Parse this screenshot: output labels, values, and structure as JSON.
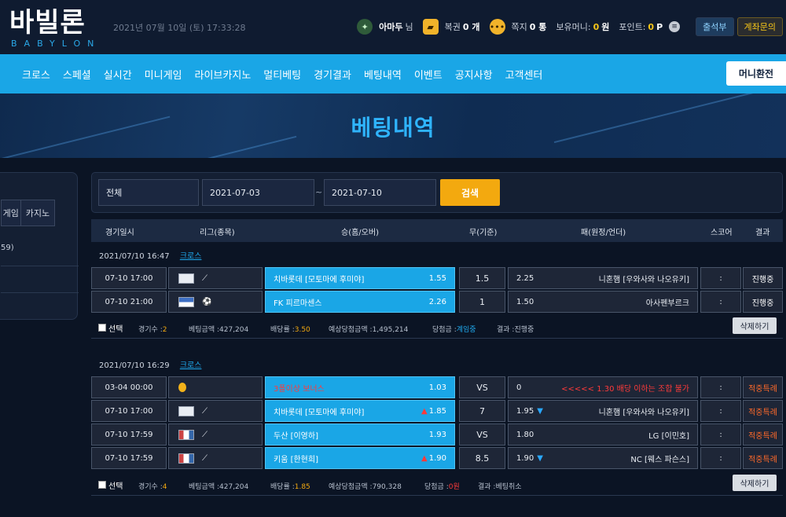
{
  "header": {
    "logo_kr": "바빌론",
    "logo_en": "BABYLON",
    "datetime": "2021년 07월 10일 (토) 17:33:28",
    "username": "아마두",
    "user_suffix": "님",
    "ticket_label": "복권",
    "ticket_value": "0 개",
    "msg_label": "쪽지",
    "msg_value": "0 통",
    "money_label": "보유머니:",
    "money_value": "0",
    "money_unit": "원",
    "point_label": "포인트:",
    "point_value": "0",
    "point_unit": "P",
    "attend_btn": "출석부",
    "account_btn": "계좌문의"
  },
  "nav": {
    "items": [
      "크로스",
      "스페셜",
      "실시간",
      "미니게임",
      "라이브카지노",
      "멀티베팅",
      "경기결과",
      "베팅내역",
      "이벤트",
      "공지사항",
      "고객센터"
    ],
    "money_btn": "머니환전"
  },
  "banner": {
    "title": "베팅내역"
  },
  "leftpanel": {
    "tab1": "게임",
    "tab2": "카지노",
    "text": "59)"
  },
  "search": {
    "type": "전체",
    "date_from": "2021-07-03",
    "tilde": "~",
    "date_to": "2021-07-10",
    "button": "검색"
  },
  "table_header": {
    "date": "경기일시",
    "league": "리그(종목)",
    "home": "승(홈/오버)",
    "draw": "무(기준)",
    "away": "패(원정/언더)",
    "score": "스코어",
    "result": "결과"
  },
  "groups": [
    {
      "datetime": "2021/07/10  16:47",
      "type": "크로스",
      "rows": [
        {
          "time": "07-10 17:00",
          "sport": "야구",
          "home": "치바롯데 [모토마에 후미야]",
          "home_odds": "1.55",
          "draw": "1.5",
          "away_odds": "2.25",
          "away": "니혼햄 [우와사와 나오유키]",
          "score": ":",
          "result": "진행중"
        },
        {
          "time": "07-10 21:00",
          "sport": "축구",
          "home": "FK 피르마센스",
          "home_odds": "2.26",
          "draw": "1",
          "away_odds": "1.50",
          "away": "아사펜부르크",
          "score": ":",
          "result": "진행중"
        }
      ],
      "footer": {
        "select": "선택",
        "games_label": "경기수 :",
        "games": "2",
        "amount_label": "베팅금액 :",
        "amount": "427,204",
        "rate_label": "배당률 :",
        "rate": "3.50",
        "expected_label": "예상당첨금액 :",
        "expected": "1,495,214",
        "win_label": "당첨금 :",
        "win": "계임중",
        "result_label": "결과 :",
        "result": "진행중",
        "delete": "삭제하기"
      }
    },
    {
      "datetime": "2021/07/10  16:29",
      "type": "크로스",
      "rows": [
        {
          "time": "03-04 00:00",
          "sport": "보너스",
          "home": "3폴이상 보너스",
          "home_odds": "1.03",
          "draw": "VS",
          "away_odds": "0",
          "away": "<<<<< 1.30 배당 이하는 조합 불가",
          "score": ":",
          "result": "적중특례"
        },
        {
          "time": "07-10 17:00",
          "sport": "야구",
          "home": "치바롯데 [모토마에 후미야]",
          "home_odds": "1.85",
          "draw": "7",
          "away_odds": "1.95",
          "away": "니혼햄 [우와사와 나오유키]",
          "score": ":",
          "result": "적중특례"
        },
        {
          "time": "07-10 17:59",
          "sport": "야구",
          "home": "두산 [이영하]",
          "home_odds": "1.93",
          "draw": "VS",
          "away_odds": "1.80",
          "away": "LG [이민호]",
          "score": ":",
          "result": "적중특례"
        },
        {
          "time": "07-10 17:59",
          "sport": "야구",
          "home": "키움 [한현희]",
          "home_odds": "1.90",
          "draw": "8.5",
          "away_odds": "1.90",
          "away": "NC [웨스 파슨스]",
          "score": ":",
          "result": "적중특례"
        }
      ],
      "footer": {
        "select": "선택",
        "games_label": "경기수 :",
        "games": "4",
        "amount_label": "베팅금액 :",
        "amount": "427,204",
        "rate_label": "배당률 :",
        "rate": "1.85",
        "expected_label": "예상당첨금액 :",
        "expected": "790,328",
        "win_label": "당첨금 :",
        "win": "0원",
        "result_label": "결과 :",
        "result": "베팅취소",
        "delete": "삭제하기"
      }
    }
  ],
  "colors": {
    "accent": "#1aa6e6",
    "search_btn": "#f3a90f",
    "hit": "#ff6a2a"
  }
}
